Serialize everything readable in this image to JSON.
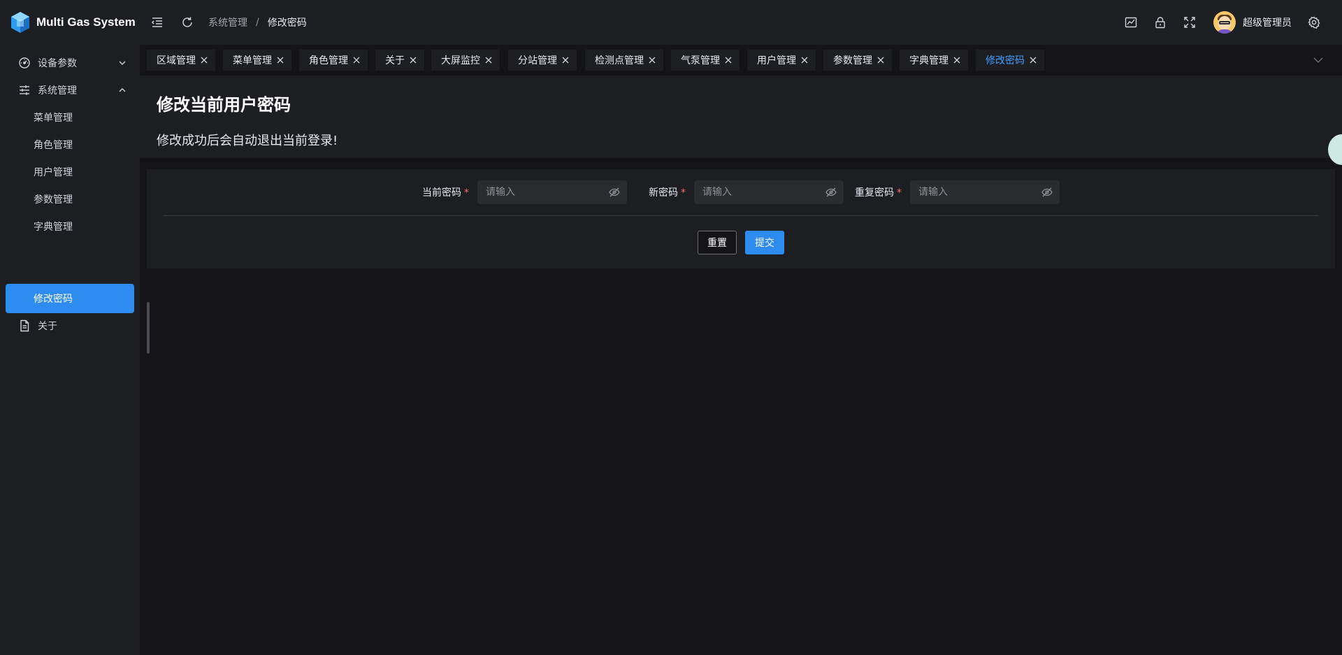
{
  "app": {
    "title": "Multi Gas System"
  },
  "breadcrumb": {
    "parent": "系统管理",
    "separator": "/",
    "current": "修改密码"
  },
  "user": {
    "name": "超级管理员"
  },
  "header_icons": [
    "fold-icon",
    "refresh-icon",
    "chart-icon",
    "lock-icon",
    "fullscreen-icon",
    "gear-icon"
  ],
  "sidebar": {
    "items": [
      {
        "label": "设备参数",
        "icon": "dashboard-icon",
        "expanded": false
      },
      {
        "label": "系统管理",
        "icon": "sliders-icon",
        "expanded": true
      },
      {
        "label": "关于",
        "icon": "document-icon"
      }
    ],
    "sub_items": [
      "菜单管理",
      "角色管理",
      "用户管理",
      "参数管理",
      "字典管理",
      "修改密码"
    ],
    "active_sub": "修改密码"
  },
  "tabs": [
    "区域管理",
    "菜单管理",
    "角色管理",
    "关于",
    "大屏监控",
    "分站管理",
    "检测点管理",
    "气泵管理",
    "用户管理",
    "参数管理",
    "字典管理",
    "修改密码"
  ],
  "active_tab": "修改密码",
  "page": {
    "title": "修改当前用户密码",
    "description": "修改成功后会自动退出当前登录!"
  },
  "form": {
    "fields": [
      {
        "label": "当前密码",
        "required_mark": "*",
        "placeholder": "请输入",
        "value": ""
      },
      {
        "label": "新密码",
        "required_mark": "*",
        "placeholder": "请输入",
        "value": ""
      },
      {
        "label": "重复密码",
        "required_mark": "*",
        "placeholder": "请输入",
        "value": ""
      }
    ],
    "reset_label": "重置",
    "submit_label": "提交"
  },
  "colors": {
    "accent": "#2e8cf0",
    "active_tab_text": "#409eff",
    "required": "#f56c6c",
    "panel": "#1d1e22",
    "background": "#141418"
  }
}
